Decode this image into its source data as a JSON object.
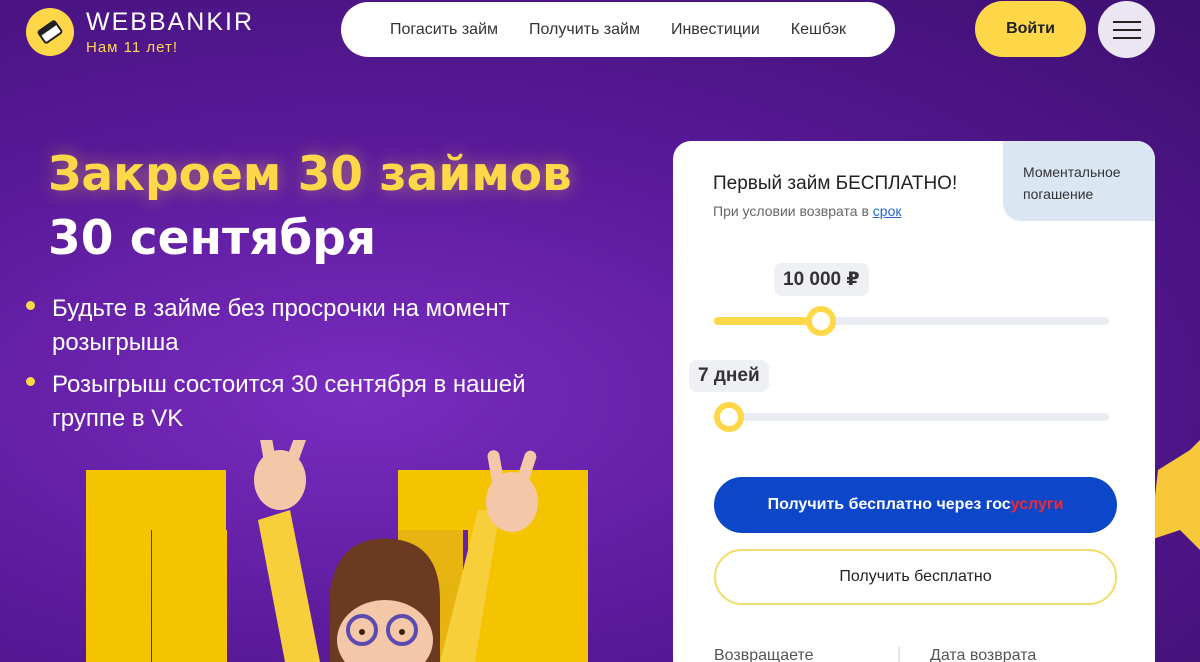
{
  "brand": {
    "name": "WEBBANKIR",
    "tagline": "Нам 11 лет!"
  },
  "nav": {
    "items": [
      "Погасить займ",
      "Получить займ",
      "Инвестиции",
      "Кешбэк"
    ]
  },
  "header": {
    "login_label": "Войти"
  },
  "hero": {
    "title_line1": "Закроем 30 займов",
    "title_line2": "30 сентября",
    "bullets": [
      "Будьте в займе без просрочки на момент розыгрыша",
      "Розыгрыш состоится 30 сентября в нашей группе в VK"
    ]
  },
  "loan_card": {
    "title": "Первый займ БЕСПЛАТНО!",
    "subtitle_prefix": "При условии возврата в ",
    "subtitle_link": "срок",
    "badge": "Моментальное погашение",
    "amount_value": "10 000 ₽",
    "amount_fill_fraction": 0.27,
    "term_value": "7 дней",
    "term_fill_fraction": 0.0,
    "gos_button_prefix": "Получить бесплатно через ",
    "gos_button_gos": "гос",
    "gos_button_uslugi": "услуги",
    "free_button": "Получить бесплатно",
    "footer_col1": "Возвращаете",
    "footer_col2": "Дата возврата"
  },
  "colors": {
    "accent_yellow": "#ffd84a",
    "background_purple": "#5a1a9a",
    "gosuslugi_blue": "#0d47c9",
    "gosuslugi_red": "#ee2a32"
  },
  "icons": {
    "logo": "wallet-icon",
    "menu": "hamburger-icon"
  }
}
